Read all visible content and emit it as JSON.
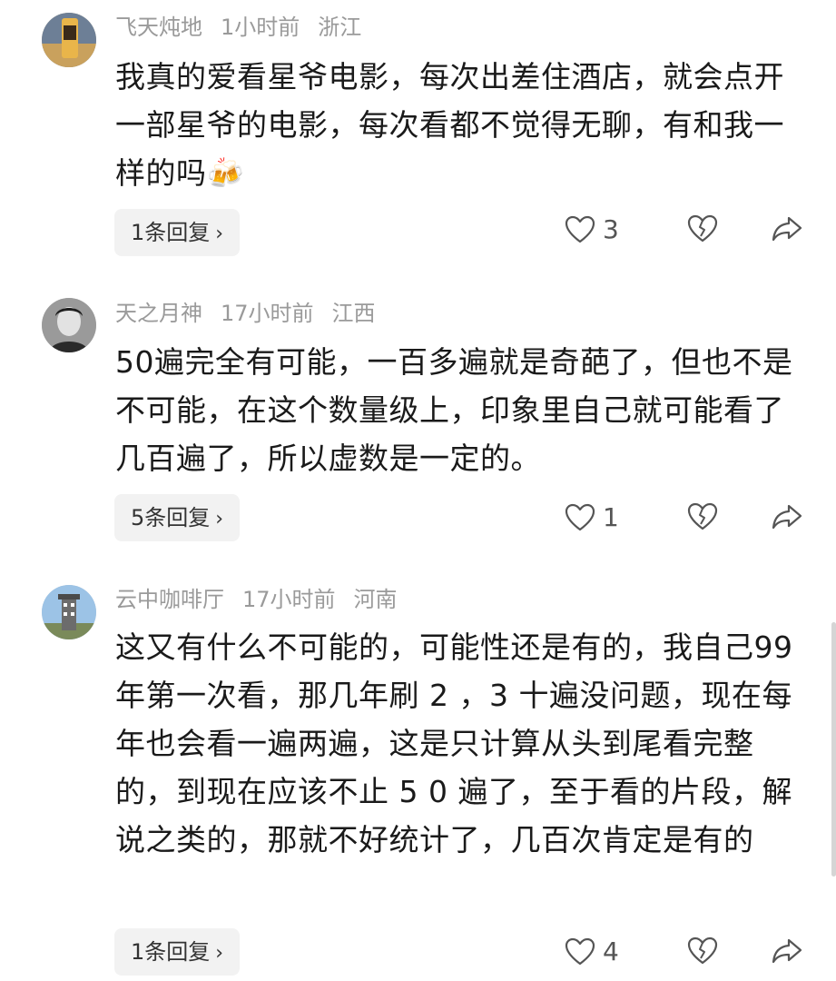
{
  "comments": [
    {
      "user": "飞天炖地",
      "time": "1小时前",
      "location": "浙江",
      "text": "我真的爱看星爷电影，每次出差住酒店，就会点开一部星爷的电影，每次看都不觉得无聊，有和我一样的吗🍻",
      "reply_label": "1条回复",
      "like_count": "3"
    },
    {
      "user": "天之月神",
      "time": "17小时前",
      "location": "江西",
      "text": "50遍完全有可能，一百多遍就是奇葩了，但也不是不可能，在这个数量级上，印象里自己就可能看了几百遍了，所以虚数是一定的。",
      "reply_label": "5条回复",
      "like_count": "1"
    },
    {
      "user": "云中咖啡厅",
      "time": "17小时前",
      "location": "河南",
      "text": "这又有什么不可能的，可能性还是有的，我自己99 年第一次看，那几年刷 2 ，3 十遍没问题，现在每年也会看一遍两遍，这是只计算从头到尾看完整的，到现在应该不止 5 0 遍了，至于看的片段，解说之类的，那就不好统计了，几百次肯定是有的",
      "reply_label": "1条回复",
      "like_count": "4"
    }
  ],
  "icons": {
    "reply_chevron": "chevron-right-icon",
    "like": "heart-outline-icon",
    "dislike": "broken-heart-icon",
    "share": "share-arrow-icon"
  },
  "colors": {
    "meta_text": "#9a9a9a",
    "reply_bg": "#f2f2f2",
    "icon_stroke": "#555555"
  }
}
